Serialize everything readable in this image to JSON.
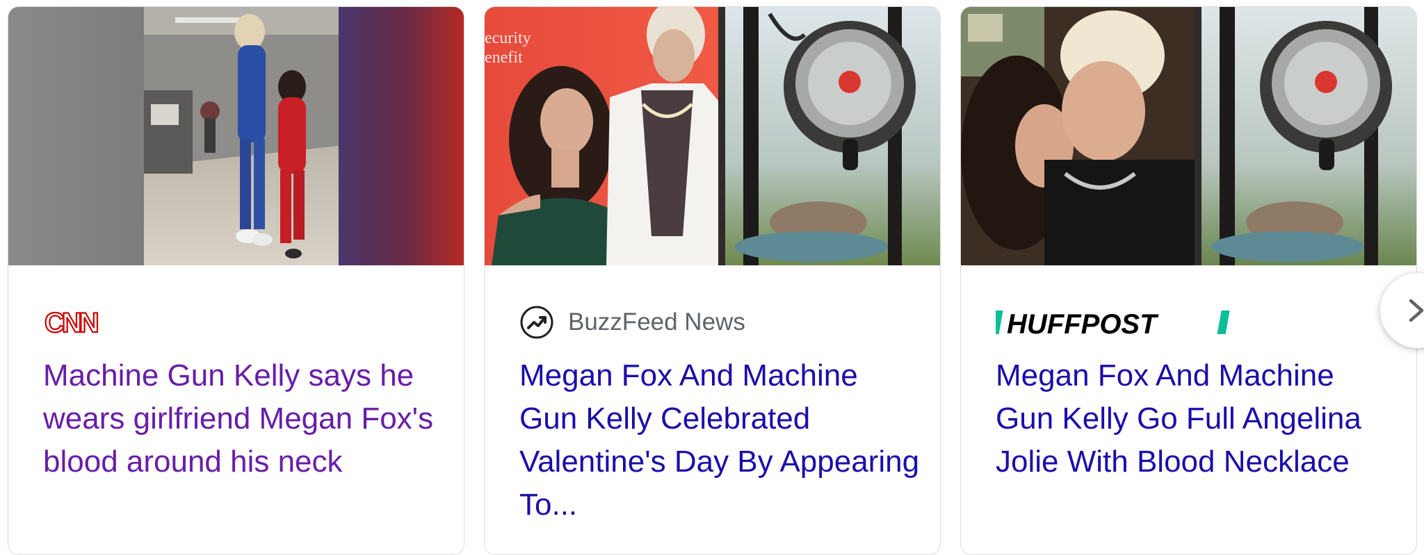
{
  "cards": [
    {
      "source": "CNN",
      "source_logo_icon": "cnn-logo",
      "headline": "Machine Gun Kelly says he wears girlfriend Megan Fox's blood around his neck",
      "visited": true
    },
    {
      "source": "BuzzFeed News",
      "source_logo_icon": "buzzfeed-trending-arrow-icon",
      "headline": "Megan Fox And Machine Gun Kelly Celebrated Valentine's Day By Appearing To...",
      "visited": false,
      "photo_text": "ecurity\nenefit"
    },
    {
      "source": "HUFFPOST",
      "source_logo_icon": "huffpost-logo",
      "headline": "Megan Fox And Machine Gun Kelly Go Full Angelina Jolie With Blood Necklace",
      "visited": false
    }
  ],
  "navigation": {
    "next_icon": "chevron-right-icon"
  },
  "colors": {
    "visited_link": "#681da8",
    "link": "#1a0dab",
    "source_text": "#5f6368",
    "cnn_red": "#cc0000",
    "huffpost_green": "#0dbe98"
  }
}
